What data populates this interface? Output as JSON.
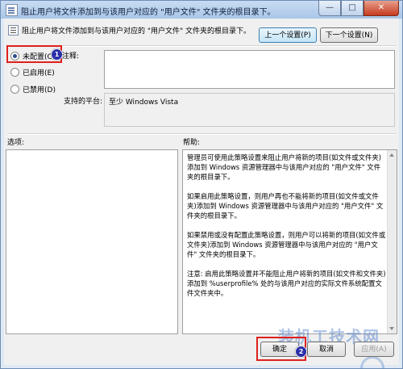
{
  "window": {
    "title": "阻止用户将文件添加到与该用户对应的 \"用户文件\" 文件夹的根目录下。",
    "minimize": "—",
    "maximize": "□",
    "close": "✕"
  },
  "policy": {
    "name": "阻止用户将文件添加到与该用户对应的 \"用户文件\" 文件夹的根目录下。",
    "prev_button": "上一个设置(P)",
    "next_button": "下一个设置(N)"
  },
  "options": {
    "not_configured": "未配置(C)",
    "enabled": "已启用(E)",
    "disabled": "已禁用(D)",
    "selected": "not_configured"
  },
  "comment": {
    "label": "注释:",
    "value": ""
  },
  "platform": {
    "label": "支持的平台:",
    "value": "至少 Windows Vista"
  },
  "sections": {
    "options_label": "选项:",
    "help_label": "帮助:"
  },
  "help": {
    "p1": "管理员可使用此策略设置来阻止用户将新的项目(如文件或文件夹)添加到 Windows 资源管理器中与该用户对应的 \"用户文件\" 文件夹的根目录下。",
    "p2": "如果启用此策略设置，则用户再也不能将新的项目(如文件或文件夹)添加到 Windows 资源管理器中与该用户对应的 \"用户文件\" 文件夹的根目录下。",
    "p3": "如果禁用或没有配置此策略设置，则用户可以将新的项目(如文件或文件夹)添加到 Windows 资源管理器中与该用户对应的 \"用户文件\" 文件夹的根目录下。",
    "p4": "注意: 启用此策略设置并不能阻止用户将新的项目(如文件和文件夹)添加到 %userprofile% 处的与该用户对应的实际文件系统配置文件文件夹中。"
  },
  "footer": {
    "ok": "确定",
    "cancel": "取消",
    "apply": "应用(A)"
  },
  "annotations": {
    "badge1": "1",
    "badge2": "2"
  },
  "watermark": "装机工技术网",
  "colors": {
    "highlight": "#e0201c",
    "badge": "#2a2fa8"
  }
}
